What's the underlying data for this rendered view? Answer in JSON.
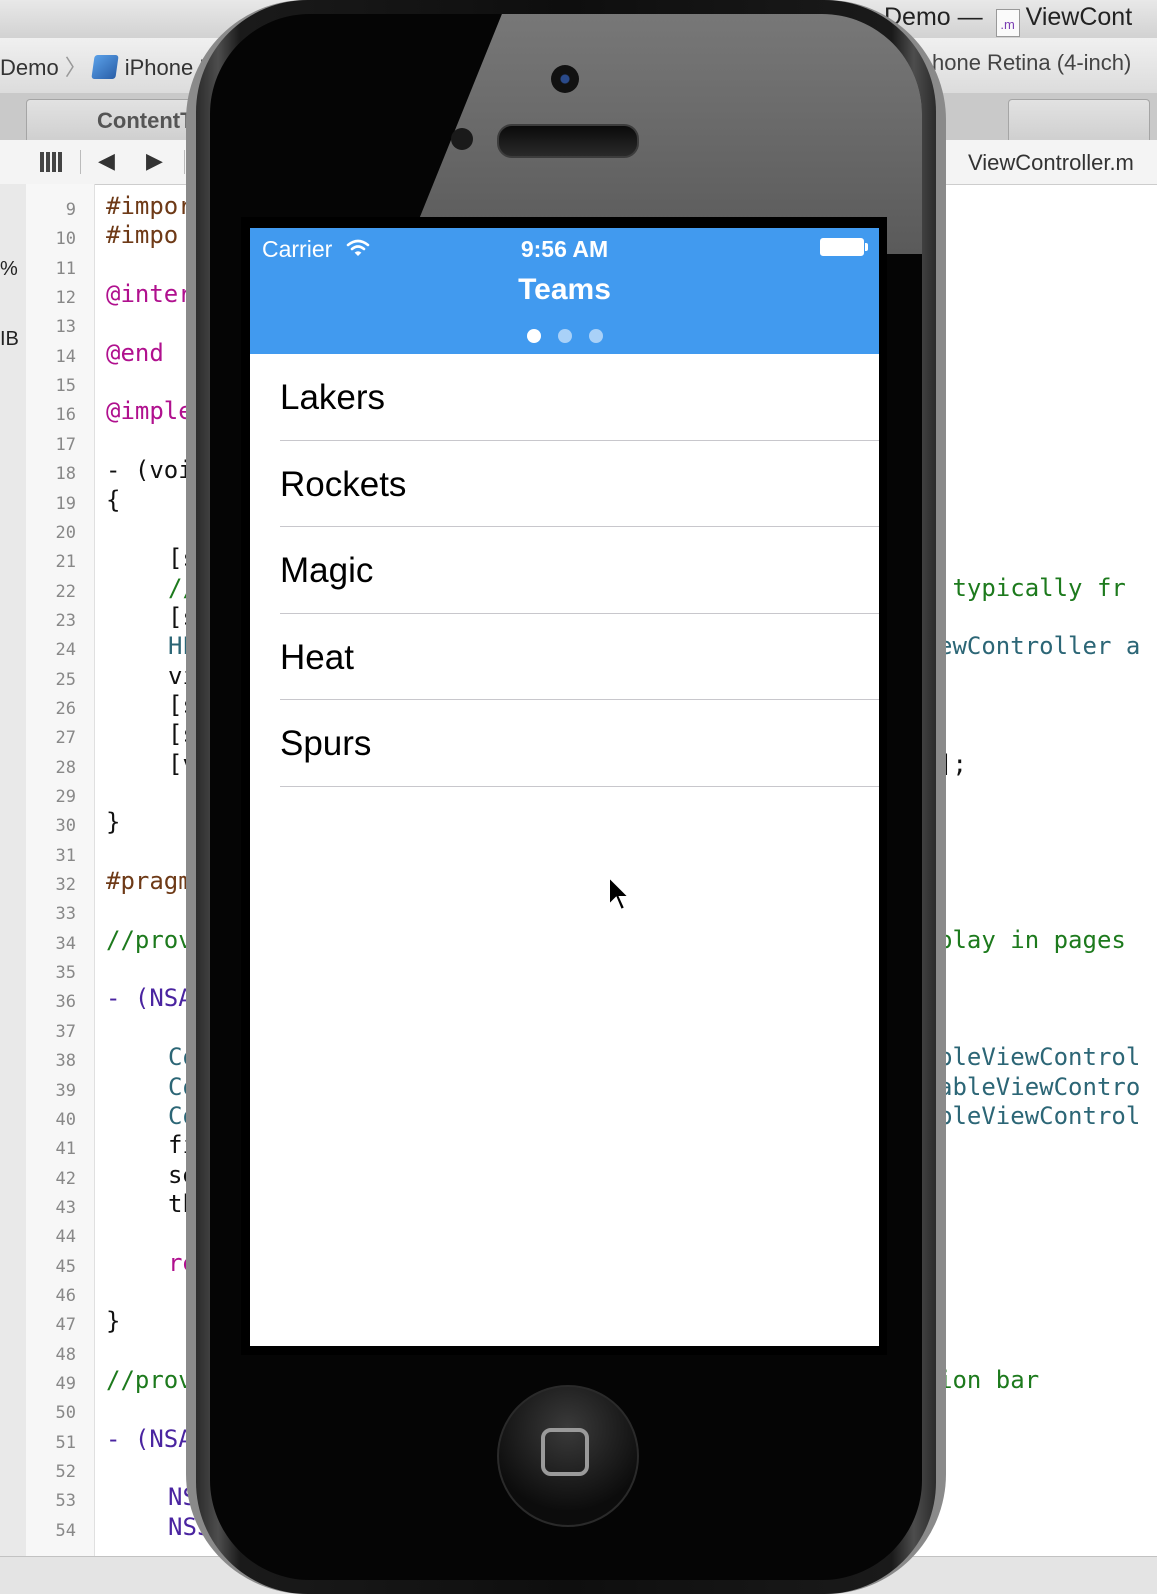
{
  "xcode": {
    "window_title_suffix": "Demo — ",
    "window_title_file": "ViewCont",
    "file_icon_glyph": ".m",
    "jump_left_project": "Demo",
    "jump_left_device": "iPhone R",
    "jump_right_device": "hone Retina (4-inch)",
    "tab_label": "ContentT",
    "toolbar_filename": "ViewController.m",
    "side_labels": [
      "%",
      "IB"
    ],
    "line_numbers": [
      "9",
      "10",
      "11",
      "12",
      "13",
      "14",
      "15",
      "16",
      "17",
      "18",
      "19",
      "20",
      "21",
      "22",
      "23",
      "24",
      "25",
      "26",
      "27",
      "28",
      "29",
      "30",
      "31",
      "32",
      "33",
      "34",
      "35",
      "36",
      "37",
      "38",
      "39",
      "40",
      "41",
      "42",
      "43",
      "44",
      "45",
      "46",
      "47",
      "48",
      "49",
      "50",
      "51",
      "52",
      "53",
      "54"
    ],
    "code_left": [
      {
        "line": "9",
        "text": "#impor",
        "cls": "c-pp",
        "indent": 0
      },
      {
        "line": "10",
        "text": "#impo",
        "cls": "c-pp",
        "indent": 0
      },
      {
        "line": "12",
        "text": "@inter",
        "cls": "c-kw",
        "indent": 0
      },
      {
        "line": "14",
        "text": "@end",
        "cls": "c-kw",
        "indent": 0
      },
      {
        "line": "16",
        "text": "@imple",
        "cls": "c-kw",
        "indent": 0
      },
      {
        "line": "18",
        "text": "- (voi",
        "cls": "c-pl",
        "indent": 0
      },
      {
        "line": "19",
        "text": "{",
        "cls": "c-pl",
        "indent": 0
      },
      {
        "line": "21",
        "text": "[s",
        "cls": "c-pl",
        "indent": 1
      },
      {
        "line": "22",
        "text": "//",
        "cls": "c-cm",
        "indent": 1
      },
      {
        "line": "23",
        "text": "[s",
        "cls": "c-pl",
        "indent": 1
      },
      {
        "line": "24",
        "text": "HP",
        "cls": "c-cl",
        "indent": 1
      },
      {
        "line": "25",
        "text": "vi",
        "cls": "c-pl",
        "indent": 1
      },
      {
        "line": "26",
        "text": "[s",
        "cls": "c-pl",
        "indent": 1
      },
      {
        "line": "27",
        "text": "[s",
        "cls": "c-pl",
        "indent": 1
      },
      {
        "line": "28",
        "text": "[v",
        "cls": "c-pl",
        "indent": 1
      },
      {
        "line": "30",
        "text": "}",
        "cls": "c-pl",
        "indent": 0
      },
      {
        "line": "32",
        "text": "#pragm",
        "cls": "c-pp",
        "indent": 0
      },
      {
        "line": "34",
        "text": "//prov",
        "cls": "c-cm",
        "indent": 0
      },
      {
        "line": "36",
        "text": "- (NSA",
        "cls": "c-ty",
        "indent": 0
      },
      {
        "line": "38",
        "text": "Co",
        "cls": "c-cl",
        "indent": 1
      },
      {
        "line": "39",
        "text": "Co",
        "cls": "c-cl",
        "indent": 1
      },
      {
        "line": "40",
        "text": "Co",
        "cls": "c-cl",
        "indent": 1
      },
      {
        "line": "41",
        "text": "fi",
        "cls": "c-pl",
        "indent": 1
      },
      {
        "line": "42",
        "text": "se",
        "cls": "c-pl",
        "indent": 1
      },
      {
        "line": "43",
        "text": "th",
        "cls": "c-pl",
        "indent": 1
      },
      {
        "line": "45",
        "text": "re",
        "cls": "c-kw",
        "indent": 1
      },
      {
        "line": "47",
        "text": "}",
        "cls": "c-pl",
        "indent": 0
      },
      {
        "line": "49",
        "text": "//prov",
        "cls": "c-cm",
        "indent": 0
      },
      {
        "line": "51",
        "text": "- (NSA",
        "cls": "c-ty",
        "indent": 0
      },
      {
        "line": "53",
        "text": "NSS",
        "cls": "c-ty",
        "indent": 1
      },
      {
        "line": "54",
        "text": "NSSt",
        "cls": "c-ty",
        "indent": 1
      }
    ],
    "code_right": [
      {
        "line": "22",
        "text": " typically fr",
        "cls": "c-cm"
      },
      {
        "line": "24",
        "text": "ewController a",
        "cls": "c-cl"
      },
      {
        "line": "28",
        "text": "];",
        "cls": "c-pl"
      },
      {
        "line": "34",
        "text": "play in pages",
        "cls": "c-cm"
      },
      {
        "line": "38",
        "text": "bleViewControl",
        "cls": "c-cl"
      },
      {
        "line": "39",
        "text": "ableViewContro",
        "cls": "c-cl"
      },
      {
        "line": "40",
        "text": "bleViewControl",
        "cls": "c-cl"
      },
      {
        "line": "49",
        "text": "ion bar",
        "cls": "c-cm"
      }
    ]
  },
  "ios": {
    "status": {
      "carrier": "Carrier",
      "time": "9:56 AM"
    },
    "nav_title": "Teams",
    "page_count": 3,
    "current_page": 1,
    "teams": [
      "Lakers",
      "Rockets",
      "Magic",
      "Heat",
      "Spurs"
    ],
    "colors": {
      "navbar": "#419aef",
      "separator": "#c8c7cc"
    }
  },
  "icons": [
    "wifi-icon",
    "battery-icon",
    "cursor-arrow-icon",
    "home-button-icon",
    "xcode-project-icon",
    "objc-file-icon",
    "grid-icon",
    "back-arrow-icon",
    "forward-arrow-icon"
  ]
}
